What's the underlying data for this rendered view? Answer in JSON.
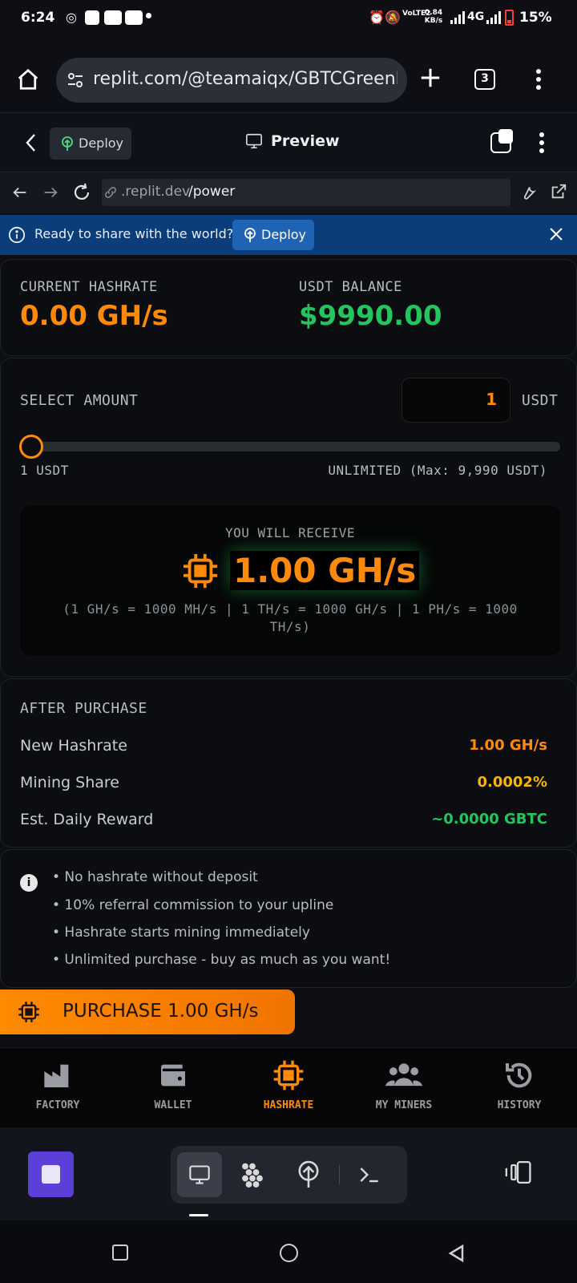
{
  "status_bar": {
    "time": "6:24",
    "network": "4G",
    "battery": "15%",
    "speed": "0.84 KB/s",
    "volte": "VoLTE2"
  },
  "browser": {
    "url": "replit.com/@teamaiqx/GBTCGreenMi",
    "tab_count": "3"
  },
  "replit_header": {
    "deploy_label": "Deploy",
    "title": "Preview"
  },
  "nav_row": {
    "address_prefix": ".replit.dev",
    "address_path": "/power"
  },
  "banner": {
    "text": "Ready to share with the world?",
    "button": "Deploy"
  },
  "stats": {
    "hashrate_label": "CURRENT HASHRATE",
    "hashrate_value": "0.00 GH/s",
    "balance_label": "USDT BALANCE",
    "balance_value": "$9990.00"
  },
  "select": {
    "label": "SELECT AMOUNT",
    "amount": "1",
    "unit": "USDT",
    "min_label": "1 USDT",
    "max_label": "UNLIMITED (Max: 9,990 USDT)",
    "slider_fraction": 0.0
  },
  "receive": {
    "label": "YOU WILL RECEIVE",
    "value": "1.00 GH/s",
    "note": "(1 GH/s = 1000 MH/s | 1 TH/s = 1000 GH/s | 1 PH/s = 1000 TH/s)"
  },
  "after": {
    "title": "AFTER PURCHASE",
    "rows": [
      {
        "label": "New Hashrate",
        "value": "1.00 GH/s",
        "color": "#ff8a0a"
      },
      {
        "label": "Mining Share",
        "value": "0.0002%",
        "color": "#f5b50b"
      },
      {
        "label": "Est. Daily Reward",
        "value": "~0.0000 GBTC",
        "color": "#22c55e"
      }
    ]
  },
  "info": {
    "items": [
      "• No hashrate without deposit",
      "• 10% referral commission to your upline",
      "• Hashrate starts mining immediately",
      "• Unlimited purchase - buy as much as you want!"
    ]
  },
  "purchase_button": "PURCHASE 1.00 GH/s",
  "app_nav": {
    "items": [
      {
        "label": "FACTORY",
        "icon": "factory-icon"
      },
      {
        "label": "WALLET",
        "icon": "wallet-icon"
      },
      {
        "label": "HASHRATE",
        "icon": "chip-icon"
      },
      {
        "label": "MY MINERS",
        "icon": "users-icon"
      },
      {
        "label": "HISTORY",
        "icon": "history-icon"
      }
    ],
    "active": "HASHRATE"
  },
  "colors": {
    "accent": "#ff8a0a",
    "green": "#22c55e",
    "yellow": "#f5b50b",
    "banner": "#0b3d7a"
  }
}
